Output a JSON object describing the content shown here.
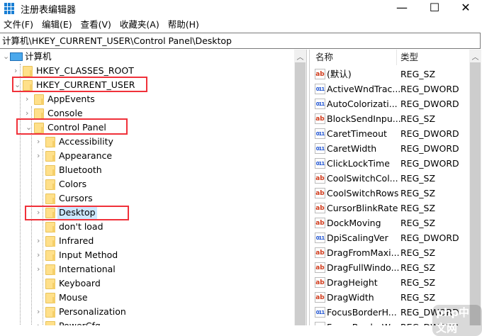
{
  "window": {
    "title": "注册表编辑器",
    "minimize": "—",
    "maximize": "☐",
    "close": "✕"
  },
  "menu": [
    "文件(F)",
    "编辑(E)",
    "查看(V)",
    "收藏夹(A)",
    "帮助(H)"
  ],
  "address": "计算机\\HKEY_CURRENT_USER\\Control Panel\\Desktop",
  "tree": [
    {
      "label": "计算机",
      "level": 0,
      "exp": "⌄",
      "icon": "computer"
    },
    {
      "label": "HKEY_CLASSES_ROOT",
      "level": 1,
      "exp": "›"
    },
    {
      "label": "HKEY_CURRENT_USER",
      "level": 1,
      "exp": "⌄"
    },
    {
      "label": "AppEvents",
      "level": 2,
      "exp": "›"
    },
    {
      "label": "Console",
      "level": 2,
      "exp": "›"
    },
    {
      "label": "Control Panel",
      "level": 2,
      "exp": "⌄"
    },
    {
      "label": "Accessibility",
      "level": 3,
      "exp": "›"
    },
    {
      "label": "Appearance",
      "level": 3,
      "exp": "›"
    },
    {
      "label": "Bluetooth",
      "level": 3,
      "exp": ""
    },
    {
      "label": "Colors",
      "level": 3,
      "exp": ""
    },
    {
      "label": "Cursors",
      "level": 3,
      "exp": ""
    },
    {
      "label": "Desktop",
      "level": 3,
      "exp": "›",
      "selected": true
    },
    {
      "label": "don't load",
      "level": 3,
      "exp": ""
    },
    {
      "label": "Infrared",
      "level": 3,
      "exp": "›"
    },
    {
      "label": "Input Method",
      "level": 3,
      "exp": "›"
    },
    {
      "label": "International",
      "level": 3,
      "exp": "›"
    },
    {
      "label": "Keyboard",
      "level": 3,
      "exp": ""
    },
    {
      "label": "Mouse",
      "level": 3,
      "exp": ""
    },
    {
      "label": "Personalization",
      "level": 3,
      "exp": "›"
    },
    {
      "label": "PowerCfg",
      "level": 3,
      "exp": "›"
    }
  ],
  "list": {
    "columns": [
      "名称",
      "类型"
    ],
    "rows": [
      {
        "name": "(默认)",
        "type": "REG_SZ"
      },
      {
        "name": "ActiveWndTrac...",
        "type": "REG_DWORD"
      },
      {
        "name": "AutoColorizati...",
        "type": "REG_DWORD"
      },
      {
        "name": "BlockSendInpu...",
        "type": "REG_SZ"
      },
      {
        "name": "CaretTimeout",
        "type": "REG_DWORD"
      },
      {
        "name": "CaretWidth",
        "type": "REG_DWORD"
      },
      {
        "name": "ClickLockTime",
        "type": "REG_DWORD"
      },
      {
        "name": "CoolSwitchCol...",
        "type": "REG_SZ"
      },
      {
        "name": "CoolSwitchRows",
        "type": "REG_SZ"
      },
      {
        "name": "CursorBlinkRate",
        "type": "REG_SZ"
      },
      {
        "name": "DockMoving",
        "type": "REG_SZ"
      },
      {
        "name": "DpiScalingVer",
        "type": "REG_DWORD"
      },
      {
        "name": "DragFromMaxi...",
        "type": "REG_SZ"
      },
      {
        "name": "DragFullWindo...",
        "type": "REG_SZ"
      },
      {
        "name": "DragHeight",
        "type": "REG_SZ"
      },
      {
        "name": "DragWidth",
        "type": "REG_SZ"
      },
      {
        "name": "FocusBorderH...",
        "type": "REG_DWORD"
      },
      {
        "name": "FocusBorderW...",
        "type": "REG_DWORD"
      }
    ]
  },
  "watermark": "php中文网",
  "colors": {
    "highlight": "#f0313a",
    "selection": "#cce8ff"
  }
}
